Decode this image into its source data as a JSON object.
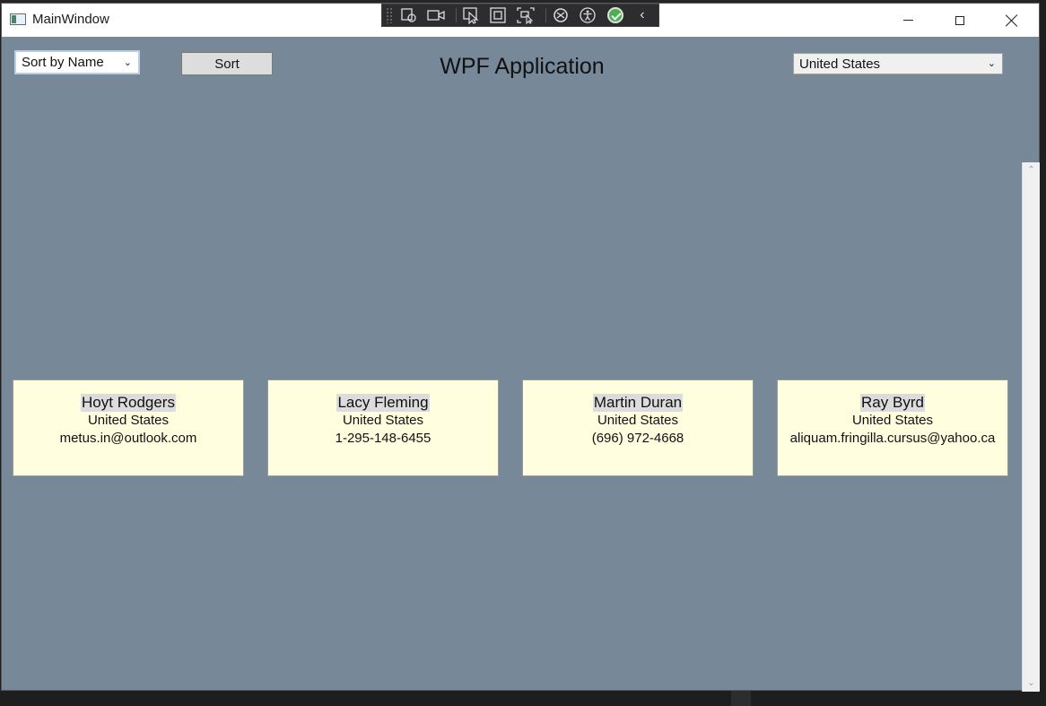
{
  "window": {
    "title": "MainWindow"
  },
  "controls": {
    "sort_combo_value": "Sort by Name",
    "sort_button_label": "Sort",
    "country_combo_value": "United States",
    "app_title": "WPF Application"
  },
  "cards": [
    {
      "name": "Hoyt Rodgers",
      "country": "United States",
      "contact": "metus.in@outlook.com"
    },
    {
      "name": "Lacy Fleming",
      "country": "United States",
      "contact": "1-295-148-6455"
    },
    {
      "name": "Martin Duran",
      "country": "United States",
      "contact": "(696) 972-4668"
    },
    {
      "name": "Ray Byrd",
      "country": "United States",
      "contact": "aliquam.fringilla.cursus@yahoo.ca"
    }
  ],
  "icons": {
    "app": "app-window-icon",
    "toolbar": [
      "select-element-icon",
      "display-layout-adorners-icon",
      "track-focused-element-icon",
      "binding-failures-icon",
      "accessibility-icon",
      "hot-reload-status-icon",
      "collapse-toolbar-icon"
    ]
  },
  "colors": {
    "window_background": "#778899",
    "card_background": "#ffffe0",
    "name_highlight": "#dcdcdc"
  }
}
